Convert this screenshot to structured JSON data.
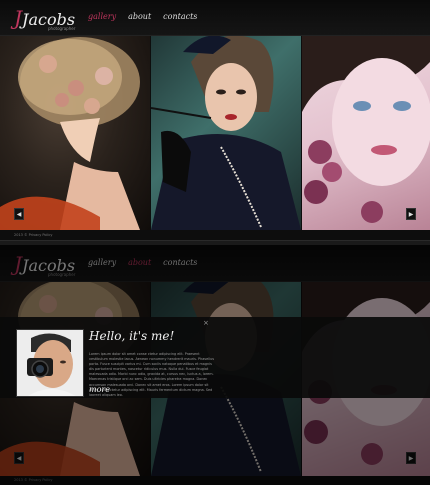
{
  "brand": {
    "initial": "J",
    "name": "Jacobs",
    "tagline": "photographer"
  },
  "nav": {
    "items": [
      {
        "label": "gallery"
      },
      {
        "label": "about"
      },
      {
        "label": "contacts"
      }
    ],
    "top_active": "gallery",
    "bottom_active": "about"
  },
  "footer": {
    "copyright": "2013 © Privacy Policy"
  },
  "gallery": {
    "panels": [
      {
        "subject": "woman-with-flowers-in-hair"
      },
      {
        "subject": "woman-with-hat-and-cigarette-holder"
      },
      {
        "subject": "woman-closeup-with-orchids"
      }
    ],
    "prev_icon": "◀",
    "next_icon": "▶"
  },
  "about": {
    "title": "Hello, it's me!",
    "close_icon": "×",
    "text": "Lorem ipsum dolor sit amet conse ctetur adipiscing elit. Praesent vestibulum molestie lacus. Aenean nonummy hendrerit mauris. Phasellus porta. Fusce suscipit varius mi. Cum sociis natoque penatibus et magnis dis parturient montes, nascetur ridiculus mus. Nulla dui. Fusce feugiat malesuada odio. Morbi nunc odio, gravida at, cursus nec, luctus a, lorem. Maecenas tristique orci ac sem. Duis ultricies pharetra magna. Donec accumsan malesuada orci. Donec sit amet eros. Lorem ipsum dolor sit amet, consectetur adipiscing elit. Mauris fermentum dictum magna. Sed laoreet aliquam leo.",
    "more_label": "more"
  },
  "colors": {
    "accent": "#c0365e",
    "background": "#0d0d0d",
    "text": "#eeeeee"
  }
}
